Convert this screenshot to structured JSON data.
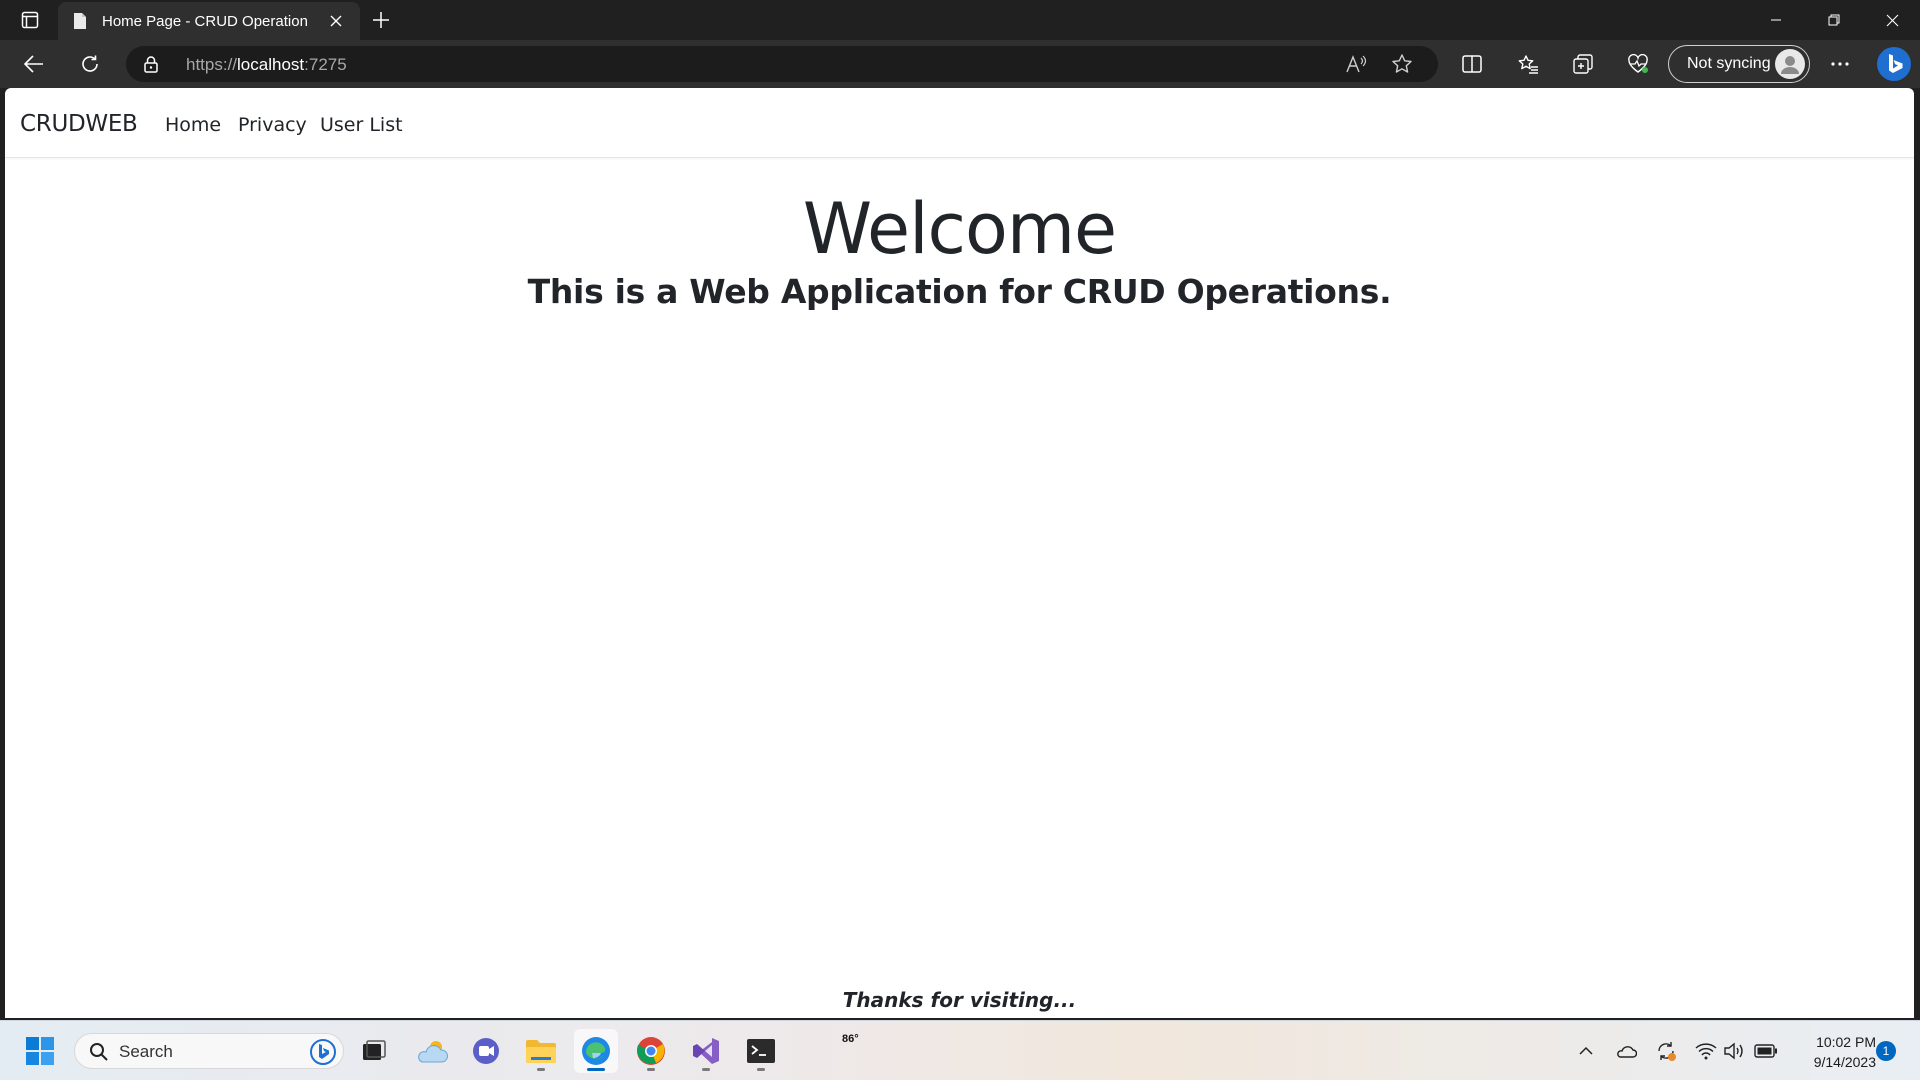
{
  "browser": {
    "tab_title": "Home Page - CRUD Operation",
    "url_scheme": "https://",
    "url_host": "localhost",
    "url_port": ":7275",
    "sync_label": "Not syncing"
  },
  "page": {
    "brand": "CRUDWEB",
    "nav": [
      "Home",
      "Privacy",
      "User List"
    ],
    "heading": "Welcome",
    "subtitle": "This is a Web Application for CRUD Operations.",
    "footer": "Thanks for visiting..."
  },
  "taskbar": {
    "search_label": "Search",
    "weather_temp": "86°",
    "time": "10:02 PM",
    "date": "9/14/2023",
    "notifications": "1"
  },
  "colors": {
    "chrome_dark": "#202020",
    "toolbar": "#2f2f2f",
    "page_text": "#212529",
    "accent": "#0067c0"
  }
}
